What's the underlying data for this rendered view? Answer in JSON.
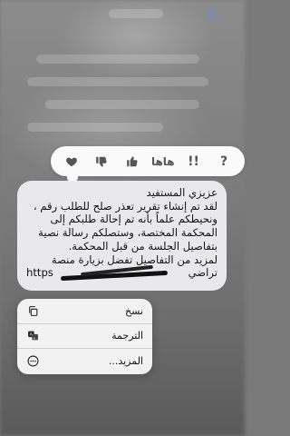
{
  "reactions": [
    {
      "name": "question-icon",
      "glyph": "?"
    },
    {
      "name": "exclamation-icon",
      "glyph": "!!"
    },
    {
      "name": "haha-icon",
      "glyph": "هاها"
    },
    {
      "name": "thumbs-down-icon",
      "glyph": ""
    },
    {
      "name": "thumbs-up-icon",
      "glyph": ""
    },
    {
      "name": "heart-icon",
      "glyph": ""
    }
  ],
  "message": {
    "lines": [
      "عزيزي المستفيد",
      "لقد تم إنشاء تقرير تعذر صلح للطلب رقم ،",
      "ونحيطكم علماً بأنه تم إحالة طلبكم إلى",
      "المحكمة المختصة، وستصلكم رسالة نصية",
      "بتفاصيل الجلسة من قبل المحكمة.",
      "لمزيد من التفاصيل تفضل بزيارة منصة",
      "تراضي"
    ],
    "url_prefix": "https"
  },
  "menu": {
    "items": [
      {
        "label": "نسخ",
        "icon": "copy-icon"
      },
      {
        "label": "الترجمة",
        "icon": "translate-icon"
      },
      {
        "label": "المزيد...",
        "icon": "more-icon"
      }
    ]
  }
}
